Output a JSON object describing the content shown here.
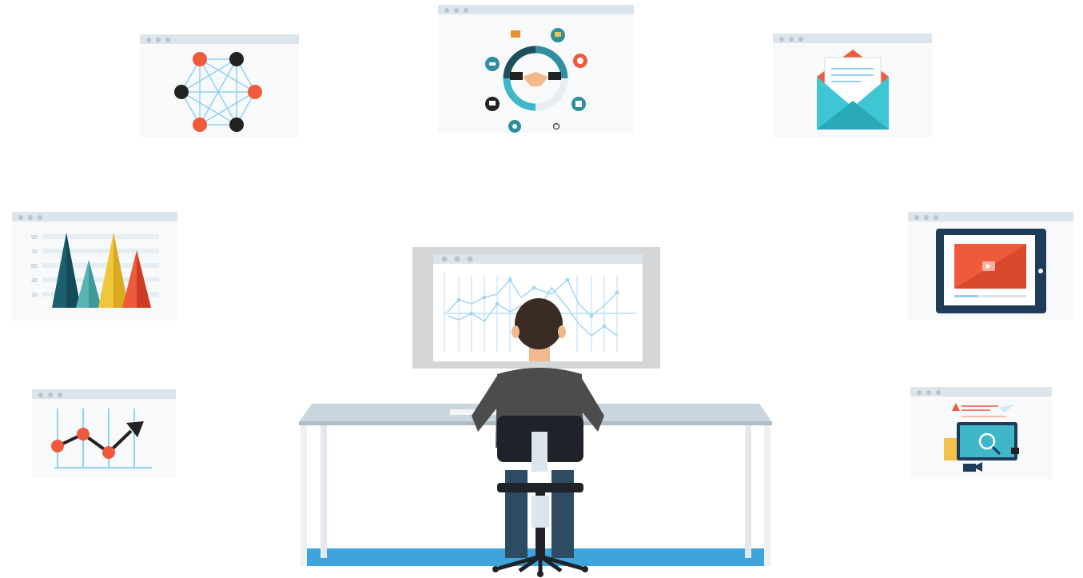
{
  "windows": [
    {
      "id": "network",
      "icon": "network-graph-icon"
    },
    {
      "id": "handshake",
      "icon": "handshake-cycle-icon"
    },
    {
      "id": "email",
      "icon": "envelope-icon"
    },
    {
      "id": "peaks",
      "icon": "mountain-chart-icon"
    },
    {
      "id": "video",
      "icon": "video-player-icon"
    },
    {
      "id": "trend",
      "icon": "trend-line-icon"
    },
    {
      "id": "web",
      "icon": "web-analytics-icon"
    }
  ],
  "peaks_chart": {
    "y_ticks": [
      "90",
      "70",
      "50",
      "30",
      "10"
    ]
  },
  "colors": {
    "accent_red": "#ef5a3c",
    "dark_node": "#222222",
    "link_blue": "#8fd3f0",
    "teal": "#2f8f9e",
    "desk_blue": "#3fa4dc",
    "shirt": "#4c4c4c",
    "hair": "#3a2c25"
  }
}
